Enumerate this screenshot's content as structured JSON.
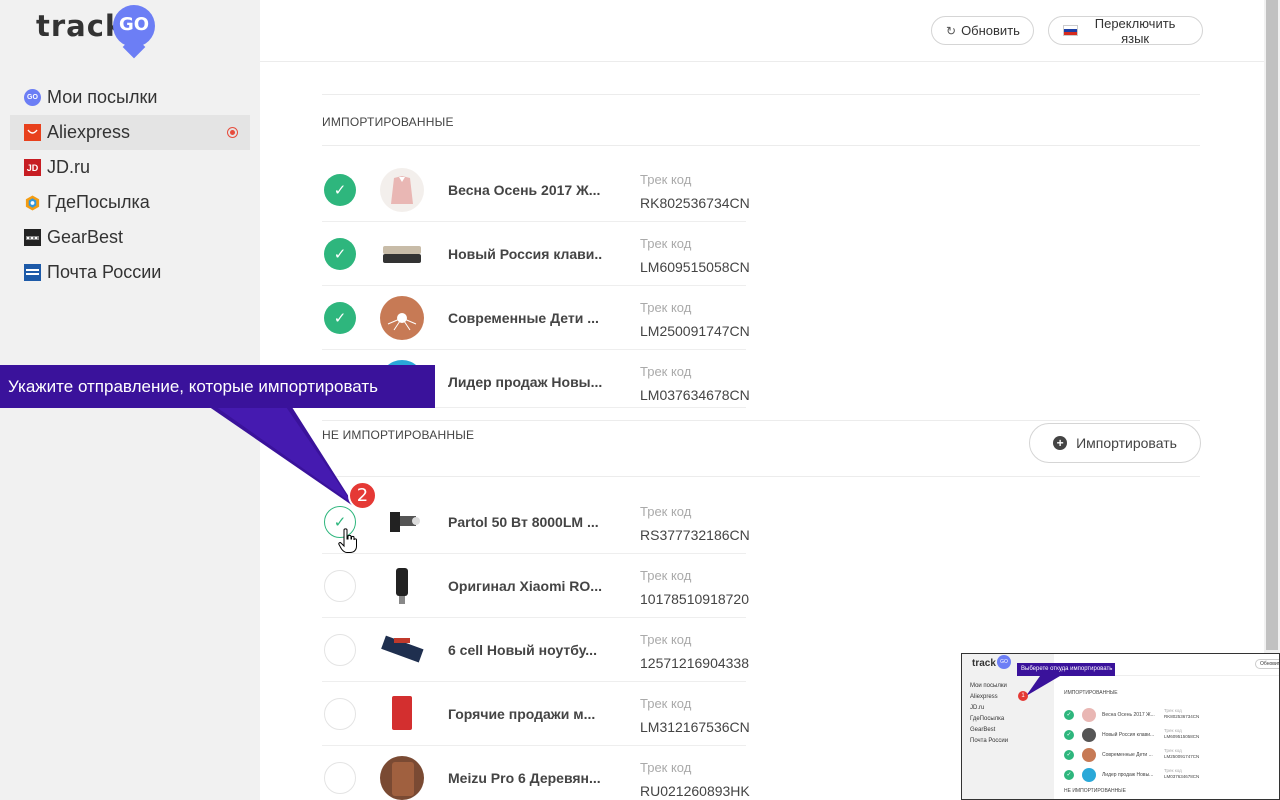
{
  "logo": {
    "text": "track",
    "badge": "GO"
  },
  "sidebar": {
    "items": [
      {
        "label": "Мои посылки",
        "icon": "trackgo-pin-icon",
        "icon_text": "GO",
        "active": false
      },
      {
        "label": "Aliexpress",
        "icon": "aliexpress-icon",
        "icon_text": "",
        "active": true
      },
      {
        "label": "JD.ru",
        "icon": "jd-icon",
        "icon_text": "JD",
        "active": false
      },
      {
        "label": "ГдеПосылка",
        "icon": "gdeposylka-icon",
        "icon_text": "",
        "active": false
      },
      {
        "label": "GearBest",
        "icon": "gearbest-icon",
        "icon_text": "",
        "active": false
      },
      {
        "label": "Почта России",
        "icon": "russian-post-icon",
        "icon_text": "",
        "active": false
      }
    ]
  },
  "header": {
    "refresh_label": "Обновить",
    "language_label": "Переключить язык"
  },
  "sections": {
    "imported_title": "ИМПОРТИРОВАННЫЕ",
    "not_imported_title": "НЕ ИМПОРТИРОВАННЫЕ",
    "import_button_label": "Импортировать"
  },
  "track_label": "Трек код",
  "imported": [
    {
      "title": "Весна Осень 2017 Ж...",
      "code": "RK802536734CN",
      "checked": true
    },
    {
      "title": "Новый Россия клави...",
      "code": "LM609515058CN",
      "checked": true
    },
    {
      "title": "Современные Дети ...",
      "code": "LM250091747CN",
      "checked": true
    },
    {
      "title": "Лидер продаж Новы...",
      "code": "LM037634678CN",
      "checked": true
    }
  ],
  "not_imported": [
    {
      "title": "Partol 50 Вт 8000LM ...",
      "code": "RS377732186CN",
      "checked": "hover"
    },
    {
      "title": "Оригинал Xiaomi RO...",
      "code": "10178510918720",
      "checked": false
    },
    {
      "title": "6 cell Новый ноутбу...",
      "code": "12571216904338",
      "checked": false
    },
    {
      "title": "Горячие продажи м...",
      "code": "LM312167536CN",
      "checked": false
    },
    {
      "title": "Meizu Pro 6 Деревян...",
      "code": "RU021260893HK",
      "checked": false
    }
  ],
  "tutorial": {
    "tooltip_text": "Укажите отправление, которые импортировать",
    "step_number": "2"
  },
  "preview": {
    "logo_text": "track",
    "logo_badge": "GO",
    "tooltip_text": "Выберете откуда импортировать",
    "step_number": "1",
    "header_button": "Обновить",
    "nav": [
      "Мои посылки",
      "Aliexpress",
      "JD.ru",
      "ГдеПосылка",
      "GearBest",
      "Почта России"
    ],
    "imported_title": "ИМПОРТИРОВАННЫЕ",
    "not_imported_title": "НЕ ИМПОРТИРОВАННЫЕ",
    "track_label": "Трек код",
    "rows": [
      {
        "title": "Весна Осень 2017 Ж...",
        "code": "RK802536734CN"
      },
      {
        "title": "Новый Россия клави...",
        "code": "LM609515058CN"
      },
      {
        "title": "Современные Дети ...",
        "code": "LM250091747CN"
      },
      {
        "title": "Лидер продаж Новы...",
        "code": "LM037634678CN"
      }
    ]
  },
  "colors": {
    "accent": "#6c7ef5",
    "check_green": "#2eb67d",
    "tooltip_purple": "#3a129b",
    "badge_red": "#e53935"
  }
}
